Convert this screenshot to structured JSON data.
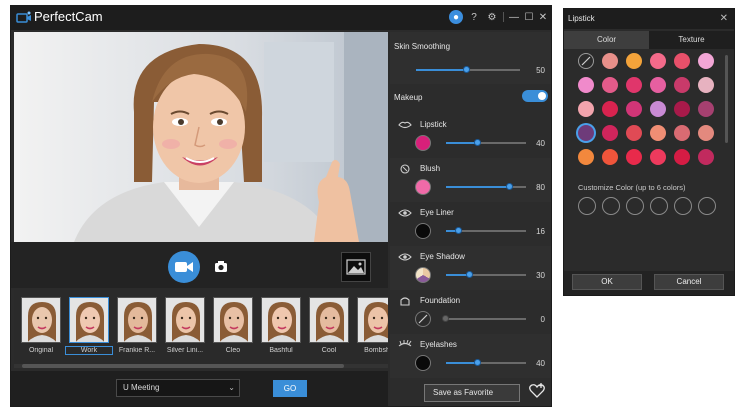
{
  "app": {
    "name": "PerfectCam",
    "controls": [
      "notifications-icon",
      "help-icon",
      "settings-icon",
      "minimize-icon",
      "maximize-icon",
      "close-icon"
    ]
  },
  "camera": {
    "mode": "video",
    "modes": [
      "video-camera-icon",
      "photo-camera-icon"
    ],
    "gallery_icon": "image-icon"
  },
  "presets": {
    "selected": "Work",
    "items": [
      {
        "label": "Original"
      },
      {
        "label": "Work"
      },
      {
        "label": "Frankie R..."
      },
      {
        "label": "Silver Lini..."
      },
      {
        "label": "Cleo"
      },
      {
        "label": "Bashful"
      },
      {
        "label": "Cool"
      },
      {
        "label": "Bombsh"
      }
    ]
  },
  "bottom_bar": {
    "select_value": "U Meeting",
    "go_label": "GO"
  },
  "panel": {
    "skin_smoothing": {
      "label": "Skin Smoothing",
      "value": "50"
    },
    "makeup": {
      "label": "Makeup",
      "enabled": true
    },
    "items": [
      {
        "label": "Lipstick",
        "value": "40",
        "level": 40,
        "swatch": "#d8207a",
        "icon": "lips-icon"
      },
      {
        "label": "Blush",
        "value": "80",
        "level": 80,
        "swatch": "#f06aa8",
        "icon": "blush-icon"
      },
      {
        "label": "Eye Liner",
        "value": "16",
        "level": 16,
        "swatch": "#0a0a0a",
        "icon": "eye-icon"
      },
      {
        "label": "Eye Shadow",
        "value": "30",
        "level": 30,
        "swatch": "eyeshadow-palette",
        "icon": "eye-icon"
      },
      {
        "label": "Foundation",
        "value": "0",
        "level": 0,
        "swatch": "none",
        "icon": "foundation-icon"
      },
      {
        "label": "Eyelashes",
        "value": "40",
        "level": 40,
        "swatch": "#0a0a0a",
        "icon": "eyelash-icon"
      }
    ],
    "save_favorite_label": "Save as Favorite",
    "favorite_icon": "heart-plus-icon"
  },
  "lipstick_dialog": {
    "title": "Lipstick",
    "tabs": [
      "Color",
      "Texture"
    ],
    "active_tab": "Color",
    "swatches": [
      "none",
      "#e8908a",
      "#f3a33a",
      "#f46a8a",
      "#e8506a",
      "#f2a6d6",
      "#f08acb",
      "#e35b8a",
      "#e0366b",
      "#e65fa0",
      "#c93a6a",
      "#e7b2c0",
      "#f2a4ad",
      "#d8234f",
      "#d13577",
      "#c98ad4",
      "#a81a4a",
      "#a64070",
      "#6e3b7a",
      "#d0255c",
      "#e04a55",
      "#f08e74",
      "#d96b72",
      "#e3897e",
      "#f2883d",
      "#f0553b",
      "#e82a4b",
      "#ee3a5d",
      "#d51c44",
      "#c12a5e"
    ],
    "selected_swatch": 18,
    "customize_label": "Customize Color (up to 6 colors)",
    "custom_slots": 6,
    "ok_label": "OK",
    "cancel_label": "Cancel"
  },
  "colors": {
    "accent": "#3a8ed8",
    "window_bg": "#2b2b2b",
    "titlebar_bg": "#1d1d1d"
  }
}
